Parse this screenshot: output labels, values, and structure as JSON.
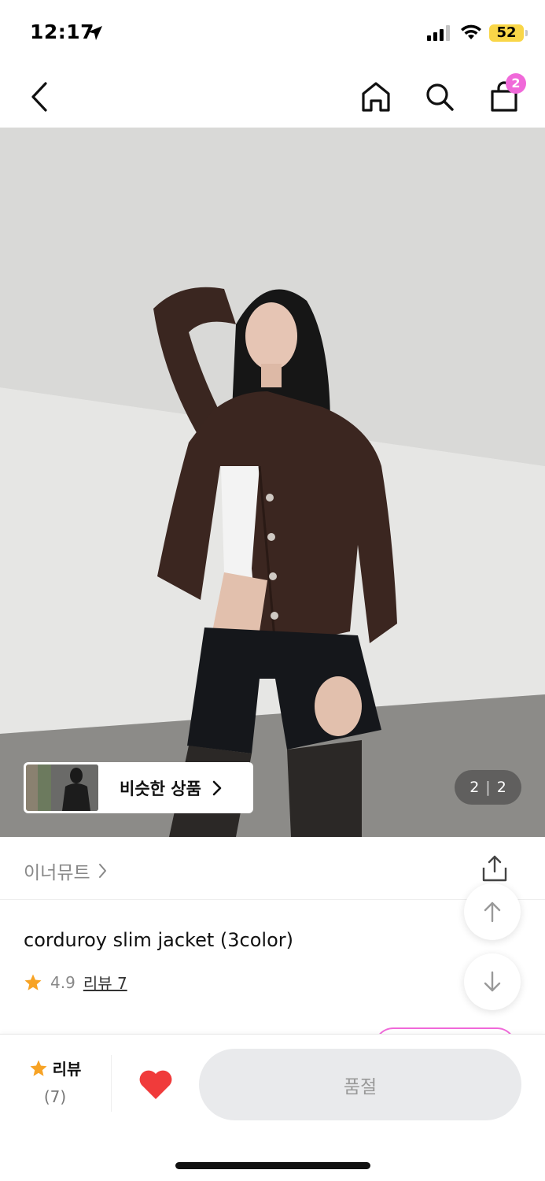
{
  "status_bar": {
    "time": "12:17",
    "battery": "52"
  },
  "nav": {
    "cart_count": "2"
  },
  "image": {
    "similar_label": "비슷한 상품",
    "page_current": "2",
    "page_separator": "|",
    "page_total": "2"
  },
  "brand": {
    "name": "이너뮤트"
  },
  "product": {
    "title": "corduroy slim jacket (3color)",
    "rating": "4.9",
    "review_link": "리뷰 7"
  },
  "bottom_bar": {
    "review_label": "리뷰",
    "review_count": "(7)",
    "soldout_label": "품절"
  },
  "colors": {
    "accent": "#f069d9",
    "heart": "#f03b3b",
    "star": "#f7a325",
    "battery": "#f9d648"
  }
}
